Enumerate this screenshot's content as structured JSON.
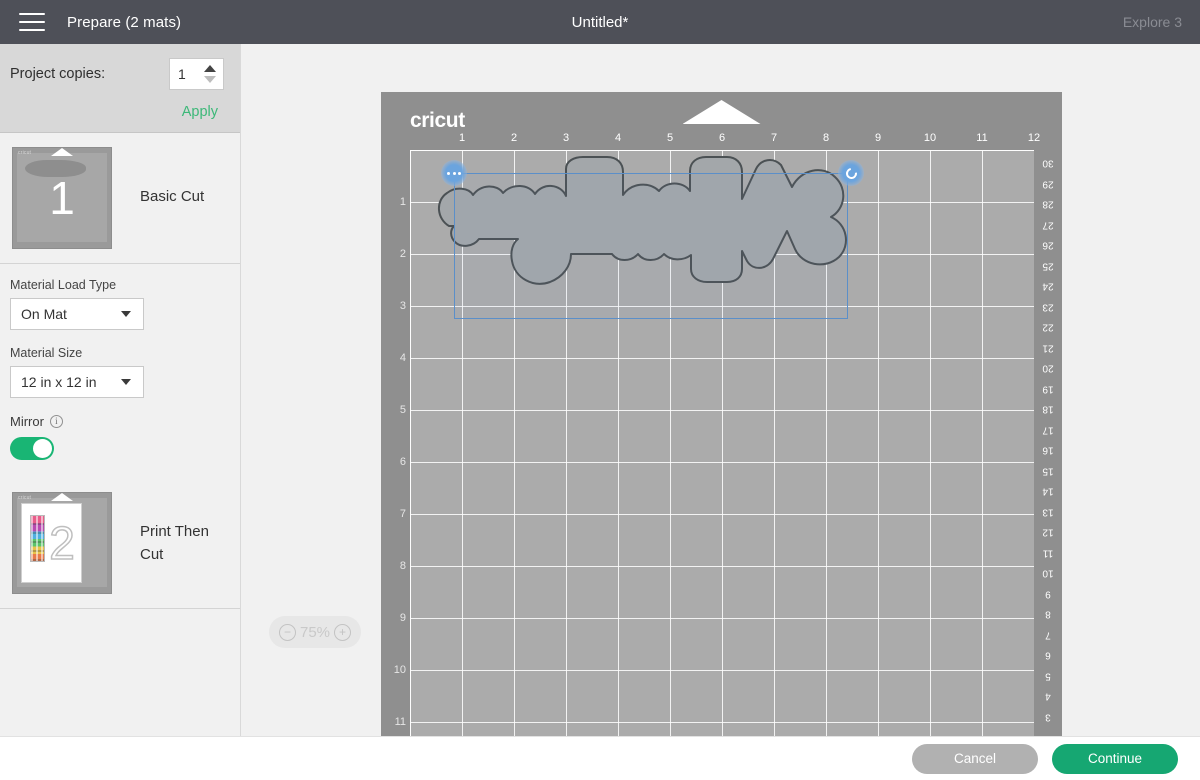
{
  "topbar": {
    "menu_icon": "hamburger-icon",
    "section_title": "Prepare (2 mats)",
    "document_title": "Untitled*",
    "machine": "Explore 3"
  },
  "sidebar": {
    "project_copies": {
      "label": "Project copies:",
      "value": "1",
      "apply_label": "Apply",
      "increment_icon": "caret-up-icon",
      "decrement_icon": "caret-down-icon"
    },
    "mats": [
      {
        "number": "1",
        "label": "Basic Cut",
        "selected": true
      },
      {
        "number": "2",
        "label": "Print Then Cut",
        "selected": false
      }
    ],
    "material_load_type": {
      "label": "Material Load Type",
      "value": "On Mat",
      "caret_icon": "chevron-down-icon"
    },
    "material_size": {
      "label": "Material Size",
      "value": "12 in x 12 in",
      "caret_icon": "chevron-down-icon"
    },
    "mirror": {
      "label": "Mirror",
      "info_icon": "info-icon",
      "info_glyph": "i",
      "enabled": true
    }
  },
  "canvas": {
    "mat_brand": "cricut",
    "ruler_top": [
      "1",
      "2",
      "3",
      "4",
      "5",
      "6",
      "7",
      "8",
      "9",
      "10",
      "11",
      "12"
    ],
    "ruler_left": [
      "1",
      "2",
      "3",
      "4",
      "5",
      "6",
      "7",
      "8",
      "9",
      "10",
      "11"
    ],
    "ruler_right": [
      "30",
      "29",
      "28",
      "27",
      "26",
      "25",
      "24",
      "23",
      "22",
      "21",
      "20",
      "19",
      "18",
      "17",
      "16",
      "15",
      "14",
      "13",
      "12",
      "11",
      "10",
      "9",
      "8",
      "7",
      "6",
      "5",
      "4",
      "3"
    ],
    "selection": {
      "more_handle_icon": "ellipsis-handle-icon",
      "rotate_handle_icon": "rotate-handle-icon"
    },
    "zoom": {
      "value": "75%",
      "zoom_out_icon": "minus-icon",
      "zoom_out_glyph": "−",
      "zoom_in_icon": "plus-icon",
      "zoom_in_glyph": "+"
    }
  },
  "footer": {
    "cancel_label": "Cancel",
    "continue_label": "Continue"
  },
  "colors": {
    "topbar_bg": "#4e5058",
    "accent_green": "#16a772",
    "apply_green": "#3cb878",
    "mat_surface": "#ababab",
    "mat_frame": "#8f8f8f",
    "selection_blue": "#5b8fc9"
  }
}
